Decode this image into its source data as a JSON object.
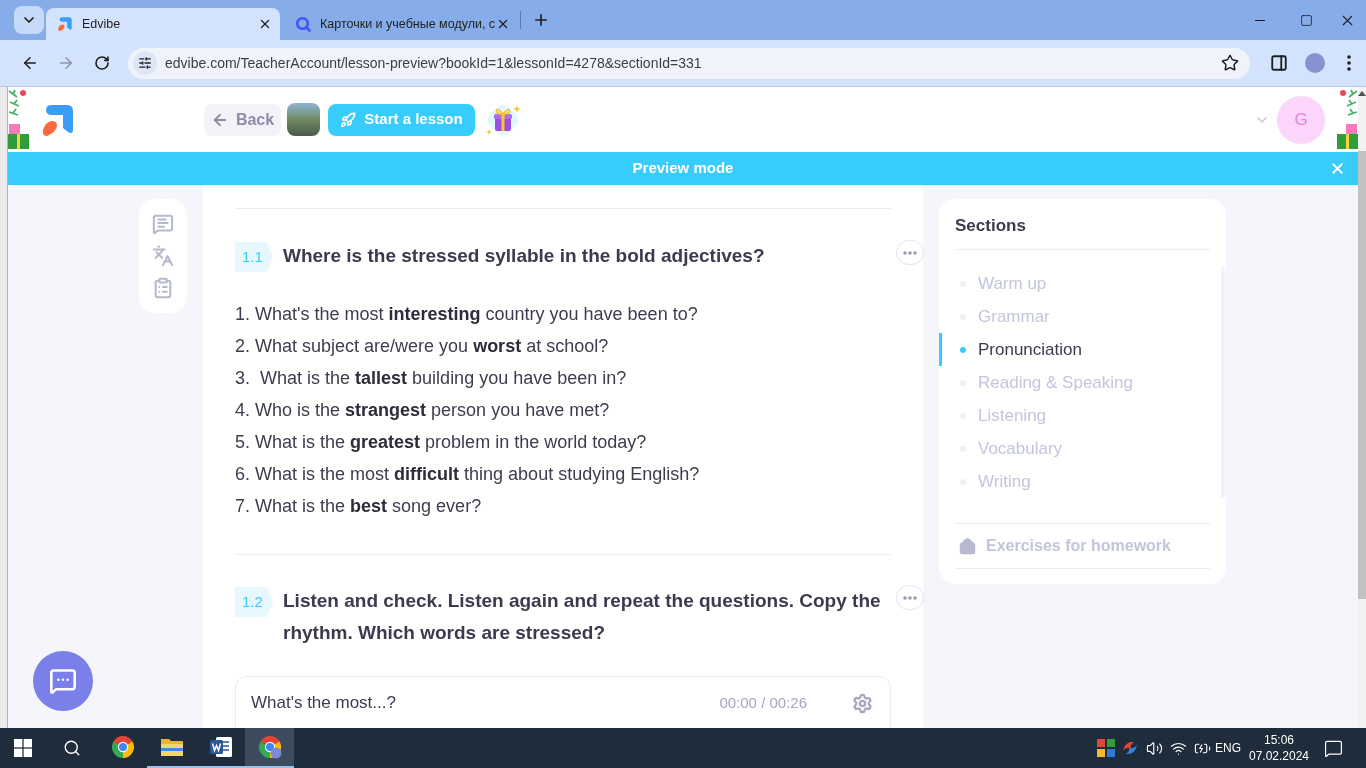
{
  "browser": {
    "tabs": [
      {
        "kind": "logo",
        "title": "Edvibe",
        "selected": true
      },
      {
        "kind": "ring",
        "title": "Карточки и учебные модули, с",
        "selected": false
      }
    ],
    "forward_enabled": false,
    "url": "edvibe.com/TeacherAccount/lesson-preview?bookId=1&lessonId=4278&sectionId=331"
  },
  "header": {
    "back": "Back",
    "start_lesson": "Start a lesson",
    "avatar_letter": "G"
  },
  "preview_bar": {
    "label": "Preview mode"
  },
  "exercises": [
    {
      "number": "1.1",
      "title": "Where is the stressed syllable in the bold adjectives?",
      "items": [
        "1. What's the most **interesting** country you have been to?",
        "2. What subject are/were you **worst** at school?",
        "3.  What is the **tallest** building you have been in?",
        "4. Who is the **strangest** person you have met?",
        "5. What is the **greatest** problem in the world today?",
        "6. What is the most **difficult** thing about studying English?",
        "7. What is the **best** song ever?"
      ]
    },
    {
      "number": "1.2",
      "title": "Listen and check. Listen again and repeat the questions. Copy the rhythm. Which words are stressed?",
      "audio": {
        "title": "What's the most...?",
        "time": "00:00 / 00:26"
      }
    }
  ],
  "sections": {
    "title": "Sections",
    "items": [
      {
        "label": "Warm up",
        "selected": false
      },
      {
        "label": "Grammar",
        "selected": false
      },
      {
        "label": "Pronunciation",
        "selected": true
      },
      {
        "label": "Reading & Speaking",
        "selected": false
      },
      {
        "label": "Listening",
        "selected": false
      },
      {
        "label": "Vocabulary",
        "selected": false
      },
      {
        "label": "Writing",
        "selected": false
      }
    ],
    "homework": "Exercises for homework"
  },
  "taskbar": {
    "apps": [
      {
        "kind": "browser",
        "open": false,
        "selected": false
      },
      {
        "kind": "folder",
        "open": true,
        "selected": false
      },
      {
        "kind": "document",
        "open": true,
        "selected": false
      },
      {
        "kind": "browser",
        "open": true,
        "selected": true
      }
    ],
    "language": "ENG",
    "time": "15:06",
    "date": "07.02.2024"
  }
}
